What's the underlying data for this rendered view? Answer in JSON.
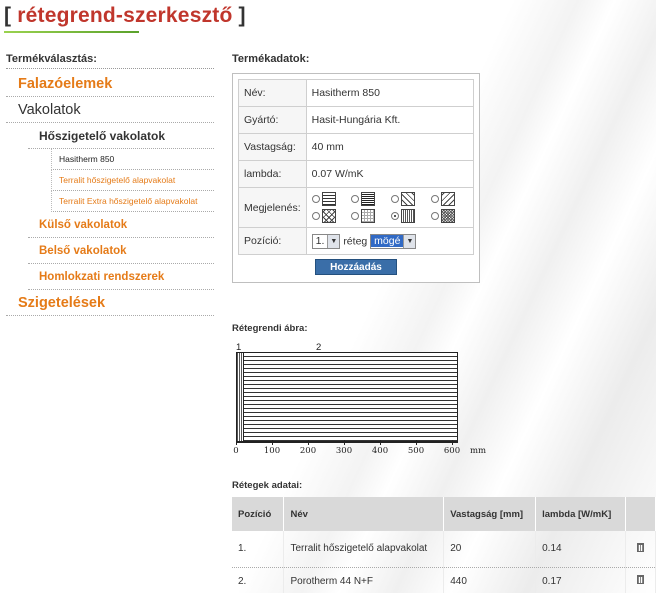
{
  "page": {
    "title": "rétegrend-szerkesztő",
    "bracket_open": "[",
    "bracket_close": "]"
  },
  "colors": {
    "accent_orange": "#e57b18",
    "title_red": "#c0362c",
    "button_blue": "#3a6ea8",
    "title_underline": "#6ab032"
  },
  "left": {
    "header": "Termékválasztás:",
    "nav": [
      {
        "label": "Falazóelemek",
        "level": 1
      },
      {
        "label": "Vakolatok",
        "level": 1
      },
      {
        "label": "Hőszigetelő vakolatok",
        "level": 2
      },
      {
        "label": "Hasitherm 850",
        "level": 3,
        "selected": true
      },
      {
        "label": "Terralit hőszigetelő alapvakolat",
        "level": 3
      },
      {
        "label": "Terralit Extra hőszigetelő alapvakolat",
        "level": 3
      },
      {
        "label": "Külső vakolatok",
        "level": 2
      },
      {
        "label": "Belső vakolatok",
        "level": 2
      },
      {
        "label": "Homlokzati rendszerek",
        "level": 2
      },
      {
        "label": "Szigetelések",
        "level": 1
      }
    ]
  },
  "product": {
    "header": "Termékadatok:",
    "name_label": "Név:",
    "name_value": "Hasitherm 850",
    "maker_label": "Gyártó:",
    "maker_value": "Hasit-Hungária Kft.",
    "thickness_label": "Vastagság:",
    "thickness_value": "40 mm",
    "lambda_label": "lambda:",
    "lambda_value": "0.07 W/mK",
    "appearance_label": "Megjelenés:",
    "patterns": [
      "horizontal-lines",
      "dense-horizontal-lines",
      "diagonal-back",
      "diagonal-forward",
      "cross-hatch",
      "dotted-grid",
      "dense-dots",
      "checker"
    ],
    "selected_pattern_index": 6,
    "position_label": "Pozíció:",
    "position_value": "1.",
    "position_word": "réteg",
    "placement_value": "mögé",
    "add_button": "Hozzáadás"
  },
  "diagram": {
    "header": "Rétegrendi ábra:",
    "layer_numbers": [
      "1",
      "2"
    ],
    "axis_ticks": [
      "0",
      "100",
      "200",
      "300",
      "400",
      "500",
      "600"
    ],
    "axis_unit": "mm"
  },
  "layers": {
    "header": "Rétegek adatai:",
    "columns": [
      "Pozíció",
      "Név",
      "Vastagság [mm]",
      "lambda [W/mK]"
    ],
    "rows": [
      {
        "pos": "1.",
        "name": "Terralit hőszigetelő alapvakolat",
        "thickness": "20",
        "lambda": "0.14"
      },
      {
        "pos": "2.",
        "name": "Porotherm 44 N+F",
        "thickness": "440",
        "lambda": "0.17"
      }
    ]
  }
}
